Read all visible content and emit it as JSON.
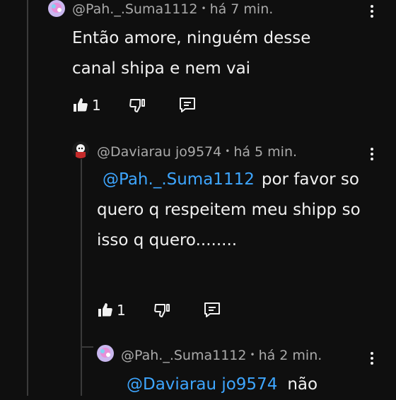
{
  "comments": [
    {
      "author": "@Pah._.Suma1112",
      "time": "há 7 min.",
      "text": "Então amore, ninguém desse canal shipa e nem vai",
      "likes": "1"
    },
    {
      "author": "@Daviarau jo9574",
      "time": "há 5 min.",
      "mention": "@Pah._.Suma1112",
      "text": "por favor so quero q respeitem meu shipp so isso q quero........",
      "likes": "1"
    },
    {
      "author": "@Pah._.Suma1112",
      "time": "há 2 min.",
      "mention": "@Daviarau jo9574",
      "text": "não"
    }
  ],
  "separator": "•",
  "icons": {
    "menu": "more-vertical-icon",
    "like": "thumbs-up-icon",
    "dislike": "thumbs-down-icon",
    "reply": "reply-comment-icon"
  },
  "colors": {
    "background": "#0f0f0f",
    "text": "#f1f1f1",
    "meta": "#aaaaaa",
    "mention": "#3ea6ff"
  }
}
